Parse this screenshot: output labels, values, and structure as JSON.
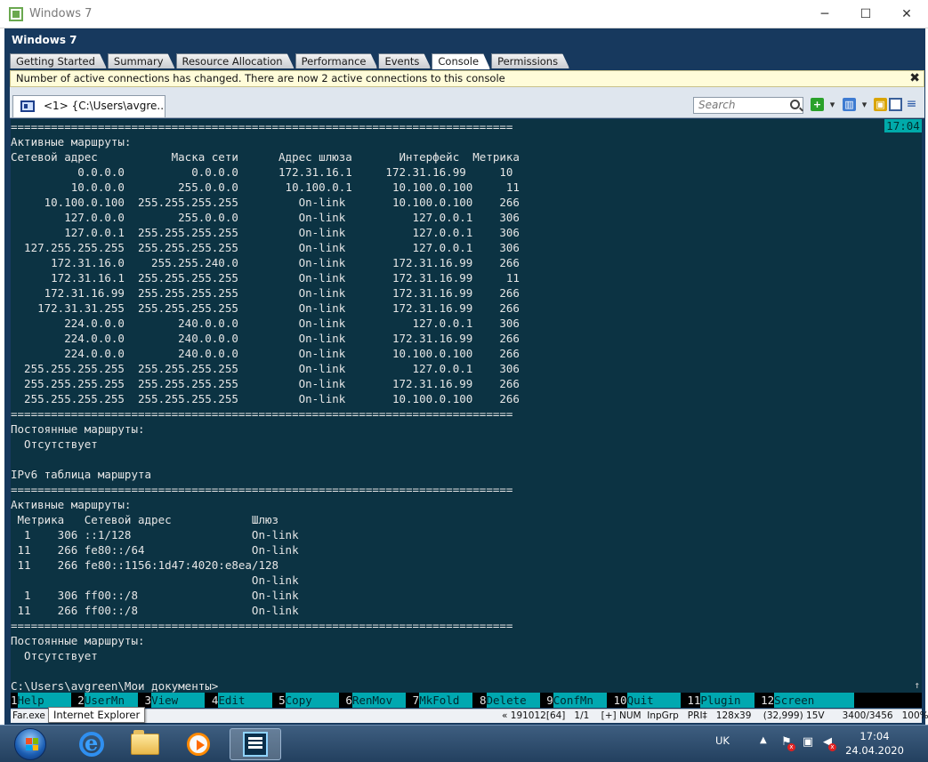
{
  "window": {
    "title": "Windows 7",
    "vm_title": "Windows 7"
  },
  "tabs": [
    {
      "label": "Getting Started"
    },
    {
      "label": "Summary"
    },
    {
      "label": "Resource Allocation"
    },
    {
      "label": "Performance"
    },
    {
      "label": "Events"
    },
    {
      "label": "Console",
      "active": true
    },
    {
      "label": "Permissions"
    }
  ],
  "notification": {
    "text": "Number of active connections has changed. There are now 2 active connections to this console"
  },
  "toolbar": {
    "console_tab": "<1> {C:\\Users\\avgre...",
    "search_placeholder": "Search"
  },
  "console": {
    "clock": "17:04",
    "lines": [
      "===========================================================================",
      "Активные маршруты:",
      "Сетевой адрес           Маска сети      Адрес шлюза       Интерфейс  Метрика",
      "          0.0.0.0          0.0.0.0      172.31.16.1     172.31.16.99     10",
      "         10.0.0.0        255.0.0.0       10.100.0.1      10.100.0.100     11",
      "     10.100.0.100  255.255.255.255         On-link       10.100.0.100    266",
      "        127.0.0.0        255.0.0.0         On-link          127.0.0.1    306",
      "        127.0.0.1  255.255.255.255         On-link          127.0.0.1    306",
      "  127.255.255.255  255.255.255.255         On-link          127.0.0.1    306",
      "      172.31.16.0    255.255.240.0         On-link       172.31.16.99    266",
      "      172.31.16.1  255.255.255.255         On-link       172.31.16.99     11",
      "     172.31.16.99  255.255.255.255         On-link       172.31.16.99    266",
      "    172.31.31.255  255.255.255.255         On-link       172.31.16.99    266",
      "        224.0.0.0        240.0.0.0         On-link          127.0.0.1    306",
      "        224.0.0.0        240.0.0.0         On-link       172.31.16.99    266",
      "        224.0.0.0        240.0.0.0         On-link       10.100.0.100    266",
      "  255.255.255.255  255.255.255.255         On-link          127.0.0.1    306",
      "  255.255.255.255  255.255.255.255         On-link       172.31.16.99    266",
      "  255.255.255.255  255.255.255.255         On-link       10.100.0.100    266",
      "===========================================================================",
      "Постоянные маршруты:",
      "  Отсутствует",
      "",
      "IPv6 таблица маршрута",
      "===========================================================================",
      "Активные маршруты:",
      " Метрика   Сетевой адрес            Шлюз",
      "  1    306 ::1/128                  On-link",
      " 11    266 fe80::/64                On-link",
      " 11    266 fe80::1156:1d47:4020:e8ea/128",
      "                                    On-link",
      "  1    306 ff00::/8                 On-link",
      " 11    266 ff00::/8                 On-link",
      "===========================================================================",
      "Постоянные маршруты:",
      "  Отсутствует",
      "",
      "C:\\Users\\avgreen\\Мои документы>"
    ]
  },
  "keybar": [
    {
      "num": "1",
      "label": "Help    "
    },
    {
      "num": " 2",
      "label": "UserMn  "
    },
    {
      "num": " 3",
      "label": "View    "
    },
    {
      "num": " 4",
      "label": "Edit    "
    },
    {
      "num": " 5",
      "label": "Copy    "
    },
    {
      "num": " 6",
      "label": "RenMov  "
    },
    {
      "num": " 7",
      "label": "MkFold  "
    },
    {
      "num": " 8",
      "label": "Delete  "
    },
    {
      "num": " 9",
      "label": "ConfMn  "
    },
    {
      "num": " 10",
      "label": "Quit    "
    },
    {
      "num": " 11",
      "label": "Plugin  "
    },
    {
      "num": " 12",
      "label": "Screen      "
    }
  ],
  "status": {
    "left": "Far.exe",
    "right": "« 191012[64]   1/1    [+] NUM  InpGrp   PRI‡   128x39    (32,999) 15V      3400/3456   100%"
  },
  "tooltip": "Internet Explorer",
  "taskbar": {
    "lang": "UK",
    "time": "17:04",
    "date": "24.04.2020"
  },
  "colors": {
    "console_bg": "#0c3343",
    "keybar_label_bg": "#00a8b0",
    "frame_bg": "#17395e"
  }
}
